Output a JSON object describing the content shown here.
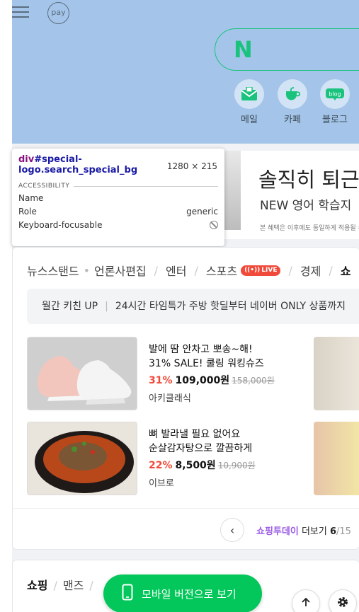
{
  "header": {
    "pay_label": "pay",
    "search_logo": "N",
    "shortcuts": [
      {
        "label": "메일",
        "icon": "mail-icon"
      },
      {
        "label": "카페",
        "icon": "cafe-icon"
      },
      {
        "label": "블로그",
        "icon": "blog-icon",
        "icon_text": "blog"
      }
    ],
    "bg_color": "#a4c5e9",
    "accent": "#19c37d"
  },
  "ad": {
    "title": "솔직히 퇴근",
    "subtitle": "NEW 영어 학습지 ",
    "note": "본 혜택은 이후에도 동일하게 적용될 수"
  },
  "devtools": {
    "tag": "div",
    "selector": "#special-logo.search_special_bg",
    "dims": "1280 × 215",
    "section": "ACCESSIBILITY",
    "name_label": "Name",
    "name_value": "",
    "role_label": "Role",
    "role_value": "generic",
    "focus_label": "Keyboard-focusable"
  },
  "news": {
    "tabs": [
      {
        "label": "뉴스스탠드"
      },
      {
        "label": "언론사편집"
      },
      {
        "label": "엔터"
      },
      {
        "label": "스포츠",
        "badge": "LIVE"
      },
      {
        "label": "경제"
      },
      {
        "label": "쇼"
      }
    ],
    "promo": {
      "tag": "월간 키친 UP",
      "text": "24시간 타임특가 주방 핫딜부터 네이버 ONLY 상품까지"
    },
    "products": [
      {
        "line1": "발에 땀 안차고 뽀송~해!",
        "line2": "31% SALE! 쿨링 워킹슈즈",
        "pct": "31%",
        "price": "109,000원",
        "old": "158,000원",
        "store": "아키클래식"
      },
      {
        "line1": "뼈 발라낼 필요 없어요",
        "line2": "순살감자탕으로 깔끔하게",
        "pct": "22%",
        "price": "8,500원",
        "old": "10,900원",
        "store": "이브로"
      }
    ],
    "pager": {
      "brand": "쇼핑투데이",
      "more": "더보기",
      "page": "6",
      "total": "/15"
    }
  },
  "shop": {
    "tabs": [
      "쇼핑",
      "맨즈",
      ""
    ]
  },
  "floating": {
    "mobile_label": "모바일 버전으로 보기",
    "up_icon": "arrow-up-icon",
    "settings_icon": "settings-icon"
  }
}
